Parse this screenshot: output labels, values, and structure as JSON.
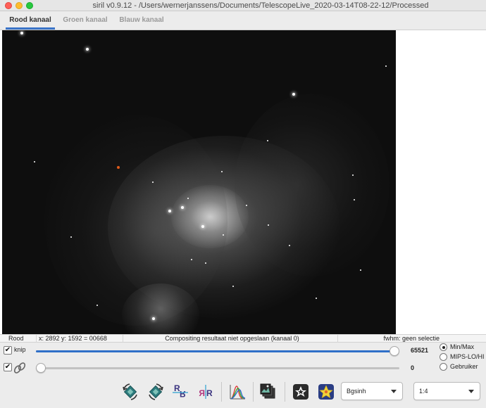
{
  "window": {
    "title": "siril v0.9.12 - /Users/wernerjanssens/Documents/TelescopeLive_2020-03-14T08-22-12/Processed"
  },
  "tabs": [
    {
      "label": "Rood kanaal",
      "active": true
    },
    {
      "label": "Groen kanaal",
      "active": false
    },
    {
      "label": "Blauw kanaal",
      "active": false
    }
  ],
  "status": {
    "channel": "Rood",
    "coords": "x: 2892 y: 1592 = 00668",
    "message": "Compositing resultaat niet opgeslaan (kanaal 0)",
    "fwhm": "fwhm: geen selectie"
  },
  "sliders": {
    "high": {
      "label": "knip",
      "value": "65521",
      "checked": true,
      "fraction": 0.9998
    },
    "low": {
      "value": "0",
      "checked": true,
      "fraction": 0.0
    }
  },
  "scale_modes": {
    "options": [
      "Min/Max",
      "MIPS-LO/HI",
      "Gebruiker"
    ],
    "selected": "Min/Max"
  },
  "toolbar": {
    "icons": [
      "rotate-left-icon",
      "rotate-right-icon",
      "mirror-x-icon",
      "mirror-y-icon",
      "histogram-icon",
      "image-stack-icon",
      "star-negative-icon",
      "star-color-icon"
    ],
    "display_mode": "Bgsinh",
    "zoom": "1:4"
  },
  "colors": {
    "accent": "#2f6fc8",
    "tab_underline": "#3a74c8",
    "image_background": "#0e0e0e",
    "cursor_marker": "#e05a1a"
  }
}
